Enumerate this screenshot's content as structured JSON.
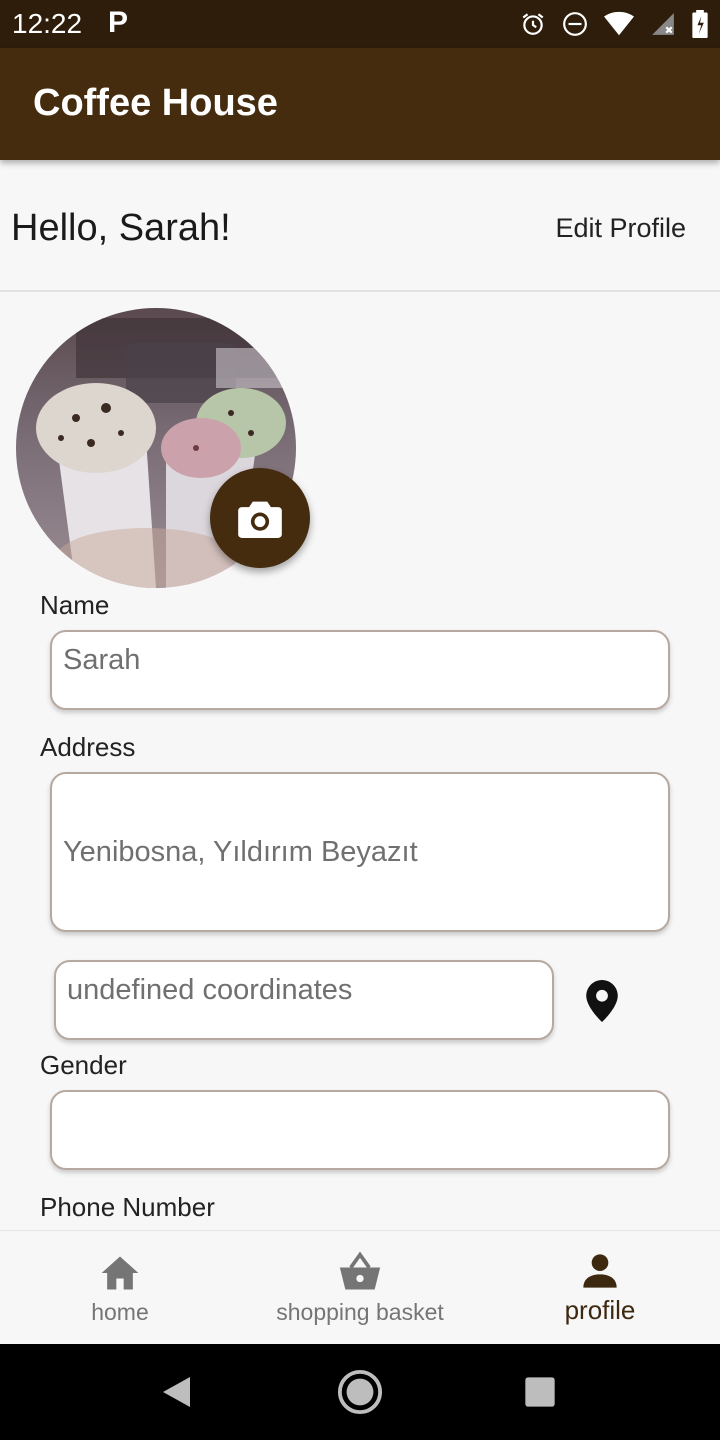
{
  "status_bar": {
    "time": "12:22",
    "app_icon": "P",
    "icons": [
      "alarm-icon",
      "do-not-disturb-icon",
      "wifi-icon",
      "signal-icon",
      "battery-icon"
    ]
  },
  "app_bar": {
    "title": "Coffee House"
  },
  "header": {
    "greeting": "Hello, Sarah!",
    "edit_label": "Edit Profile"
  },
  "avatar": {
    "icon": "camera-icon"
  },
  "form": {
    "name_label": "Name",
    "name_value": "Sarah",
    "address_label": "Address",
    "address_value": "Yenibosna, Yıldırım Beyazıt",
    "coordinates_value": "undefined coordinates",
    "gender_label": "Gender",
    "gender_value": "",
    "phone_label": "Phone Number"
  },
  "bottom_nav": {
    "items": [
      {
        "label": "home",
        "icon": "home-icon",
        "active": false
      },
      {
        "label": "shopping basket",
        "icon": "basket-icon",
        "active": false
      },
      {
        "label": "profile",
        "icon": "person-icon",
        "active": true
      }
    ]
  },
  "colors": {
    "primary": "#452c0e",
    "status_bar": "#2e1d0b",
    "background": "#f7f7f7"
  }
}
